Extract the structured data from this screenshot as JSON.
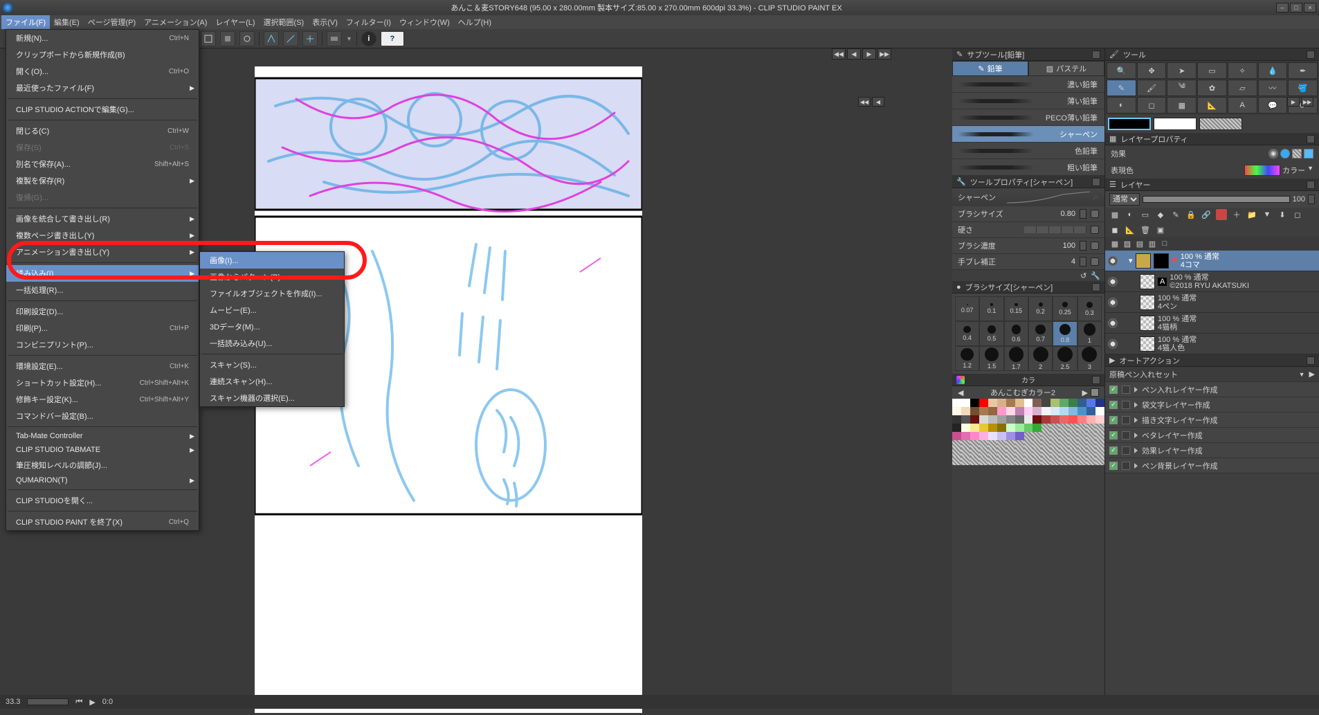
{
  "header": {
    "title": "あんこ＆麦STORY648 (95.00 x 280.00mm 製本サイズ:85.00 x 270.00mm 600dpi 33.3%)  - CLIP STUDIO PAINT EX"
  },
  "menubar": [
    "ファイル(F)",
    "編集(E)",
    "ページ管理(P)",
    "アニメーション(A)",
    "レイヤー(L)",
    "選択範囲(S)",
    "表示(V)",
    "フィルター(I)",
    "ウィンドウ(W)",
    "ヘルプ(H)"
  ],
  "file_menu": {
    "items": [
      {
        "label": "新規(N)...",
        "shortcut": "Ctrl+N"
      },
      {
        "label": "クリップボードから新規作成(B)",
        "shortcut": ""
      },
      {
        "label": "開く(O)...",
        "shortcut": "Ctrl+O"
      },
      {
        "label": "最近使ったファイル(F)",
        "shortcut": "",
        "sub": true
      },
      {
        "sep": true
      },
      {
        "label": "CLIP STUDIO  ACTIONで編集(G)...",
        "shortcut": ""
      },
      {
        "sep": true
      },
      {
        "label": "閉じる(C)",
        "shortcut": "Ctrl+W"
      },
      {
        "label": "保存(S)",
        "shortcut": "Ctrl+S",
        "disabled": true
      },
      {
        "label": "別名で保存(A)...",
        "shortcut": "Shift+Alt+S"
      },
      {
        "label": "複製を保存(R)",
        "shortcut": "",
        "sub": true
      },
      {
        "label": "復帰(G)...",
        "shortcut": "",
        "disabled": true
      },
      {
        "sep": true
      },
      {
        "label": "画像を統合して書き出し(R)",
        "shortcut": "",
        "sub": true
      },
      {
        "label": "複数ページ書き出し(Y)",
        "shortcut": "",
        "sub": true
      },
      {
        "label": "アニメーション書き出し(Y)",
        "shortcut": "",
        "sub": true
      },
      {
        "sep": true
      },
      {
        "label": "読み込み(I)",
        "shortcut": "",
        "sub": true,
        "hover": true
      },
      {
        "label": "一括処理(R)...",
        "shortcut": ""
      },
      {
        "sep": true
      },
      {
        "label": "印刷設定(D)...",
        "shortcut": ""
      },
      {
        "label": "印刷(P)...",
        "shortcut": "Ctrl+P"
      },
      {
        "label": "コンビニプリント(P)...",
        "shortcut": ""
      },
      {
        "sep": true
      },
      {
        "label": "環境設定(E)...",
        "shortcut": "Ctrl+K"
      },
      {
        "label": "ショートカット設定(H)...",
        "shortcut": "Ctrl+Shift+Alt+K"
      },
      {
        "label": "修飾キー設定(K)...",
        "shortcut": "Ctrl+Shift+Alt+Y"
      },
      {
        "label": "コマンドバー設定(B)...",
        "shortcut": ""
      },
      {
        "sep": true
      },
      {
        "label": "Tab-Mate Controller",
        "shortcut": "",
        "sub": true
      },
      {
        "label": "CLIP STUDIO TABMATE",
        "shortcut": "",
        "sub": true
      },
      {
        "label": "筆圧検知レベルの調節(J)...",
        "shortcut": ""
      },
      {
        "label": "QUMARION(T)",
        "shortcut": "",
        "sub": true
      },
      {
        "sep": true
      },
      {
        "label": "CLIP STUDIOを開く...",
        "shortcut": ""
      },
      {
        "sep": true
      },
      {
        "label": "CLIP STUDIO  PAINT を終了(X)",
        "shortcut": "Ctrl+Q"
      }
    ]
  },
  "import_submenu": [
    {
      "label": "画像(I)...",
      "hover": true
    },
    {
      "label": "画像からパターン(P)..."
    },
    {
      "label": "ファイルオブジェクトを作成(I)..."
    },
    {
      "label": "ムービー(E)..."
    },
    {
      "label": "3Dデータ(M)..."
    },
    {
      "label": "一括読み込み(U)..."
    },
    {
      "sep": true
    },
    {
      "label": "スキャン(S)..."
    },
    {
      "label": "連続スキャン(H)..."
    },
    {
      "label": "スキャン機器の選択(E)..."
    }
  ],
  "subtool": {
    "title": "サブツール[鉛筆]",
    "tabs": [
      "鉛筆",
      "パステル"
    ],
    "active_tab": 0,
    "brushes": [
      "濃い鉛筆",
      "薄い鉛筆",
      "PECO薄い鉛筆",
      "シャーペン",
      "色鉛筆",
      "粗い鉛筆"
    ],
    "active_brush": 3
  },
  "tool_property": {
    "title": "ツールプロパティ[シャーペン]",
    "curve_label": "シャーペン",
    "rows": [
      {
        "label": "ブラシサイズ",
        "value": "0.80"
      },
      {
        "label": "硬さ",
        "value": ""
      },
      {
        "label": "ブラシ濃度",
        "value": "100"
      },
      {
        "label": "手ブレ補正",
        "value": "4"
      }
    ]
  },
  "brush_size": {
    "title": "ブラシサイズ[シャーペン]",
    "sizes": [
      "0.07",
      "0.1",
      "0.15",
      "0.2",
      "0.25",
      "0.3",
      "0.4",
      "0.5",
      "0.6",
      "0.7",
      "0.8",
      "1",
      "1.2",
      "1.5",
      "1.7",
      "2",
      "2.5",
      "3"
    ],
    "selected": 10
  },
  "palette": {
    "title": "あんこむぎカラー2",
    "label": "カラ"
  },
  "palette_colors": [
    "#ffffff",
    "#ffffff",
    "#000000",
    "#ff0000",
    "#e8c8a0",
    "#d8b088",
    "#a87850",
    "#e0c090",
    "#ffffff",
    "#7f6050",
    "#444444",
    "#a8c070",
    "#5fa86a",
    "#3a7f4a",
    "#335f8f",
    "#5578e8",
    "#223388",
    "#fff8e8",
    "#f4d8b8",
    "#6f5030",
    "#a87850",
    "#8f6840",
    "#ff99cc",
    "#ffd8e8",
    "#c080b0",
    "#ffd0f0",
    "#d8b0d0",
    "#f0f4f8",
    "#d8e8f8",
    "#b8d8f0",
    "#88b8e0",
    "#5090c8",
    "#3060a0",
    "#ffffff",
    "#333333",
    "#555555",
    "#691010",
    "#d8d8d8",
    "#bcbcbc",
    "#a0a0a0",
    "#848484",
    "#686868",
    "#eaeaea",
    "#691010",
    "#a83838",
    "#c85050",
    "#e86868",
    "#ff5050",
    "#ff8080",
    "#ffb0b0",
    "#ffd0d0",
    "#232323",
    "#ffffe0",
    "#f8e890",
    "#e8c830",
    "#b89000",
    "#887000",
    "#ccffcc",
    "#99ee99",
    "#66cc66",
    "#33aa33",
    "#ffffff",
    "#ffffff",
    "#ffffff",
    "#ffffff",
    "#ffffff",
    "#ffffff",
    "#ffffff",
    "#c85090",
    "#e070b0",
    "#ff88c8",
    "#ffb0e0",
    "#e8e0ff",
    "#c8c0f0",
    "#a090e0",
    "#7060c8",
    "#ffffff",
    "#ffffff",
    "#ffffff",
    "#ffffff",
    "#ffffff",
    "#ffffff",
    "#ffffff",
    "#ffffff",
    "#ffffff",
    "#ffffff",
    "#ffffff",
    "#ffffff",
    "#ffffff",
    "#ffffff",
    "#ffffff",
    "#ffffff",
    "#ffffff",
    "#ffffff",
    "#ffffff",
    "#ffffff",
    "#ffffff",
    "#ffffff",
    "#ffffff",
    "#ffffff",
    "#ffffff",
    "#ffffff",
    "#ffffff",
    "#ffffff",
    "#ffffff",
    "#ffffff",
    "#ffffff",
    "#ffffff",
    "#ffffff",
    "#ffffff",
    "#ffffff",
    "#ffffff",
    "#ffffff",
    "#ffffff",
    "#ffffff",
    "#ffffff",
    "#ffffff",
    "#ffffff",
    "#ffffff",
    "#ffffff",
    "#ffffff",
    "#ffffff",
    "#ffffff",
    "#ffffff",
    "#ffffff",
    "#ffffff",
    "#ffffff",
    "#ffffff",
    "#ffffff",
    "#ffffff",
    "#ffffff",
    "#ffffff",
    "#ffffff",
    "#ffffff",
    "#ffffff",
    "#ffffff"
  ],
  "tool_panel": {
    "title": "ツール"
  },
  "layer_property": {
    "title": "レイヤープロパティ",
    "effect": "効果",
    "express_color": "表現色",
    "color_mode": "カラー"
  },
  "layer_panel": {
    "title": "レイヤー",
    "blend_mode": "通常",
    "opacity": "100",
    "layers": [
      {
        "name": "100 % 通常",
        "sub": "4コマ",
        "sel": true,
        "thumb": "folder"
      },
      {
        "name": "100 % 通常",
        "sub": "©2018 RYU AKATSUKI",
        "thumb": "check"
      },
      {
        "name": "100 % 通常",
        "sub": "4ペン",
        "thumb": "check"
      },
      {
        "name": "100 % 通常",
        "sub": "4猫柄",
        "thumb": "check"
      },
      {
        "name": "100 % 通常",
        "sub": "4猫人色",
        "thumb": "check"
      }
    ]
  },
  "auto_action": {
    "title": "オートアクション",
    "set": "原稿ペン入れセット",
    "items": [
      "ペン入れレイヤー作成",
      "袋文字レイヤー作成",
      "描き文字レイヤー作成",
      "ベタレイヤー作成",
      "効果レイヤー作成",
      "ペン背景レイヤー作成"
    ]
  },
  "status": {
    "zoom": "33.3",
    "time": "0:0"
  }
}
